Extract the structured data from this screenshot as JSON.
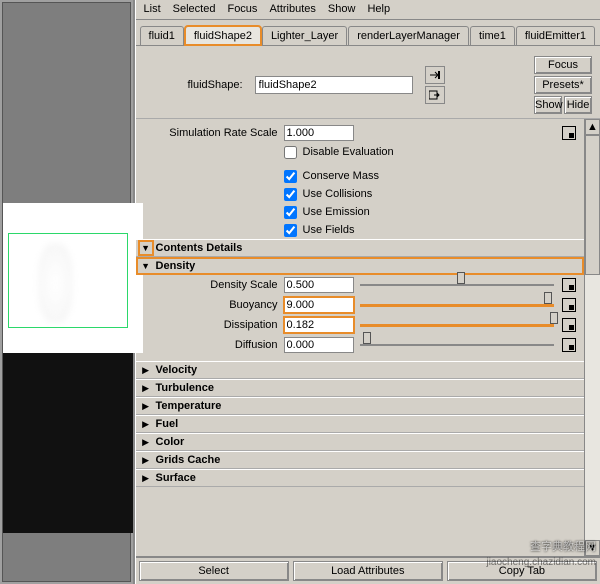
{
  "menu": {
    "items": [
      "List",
      "Selected",
      "Focus",
      "Attributes",
      "Show",
      "Help"
    ]
  },
  "tabs": [
    {
      "label": "fluid1"
    },
    {
      "label": "fluidShape2",
      "selected": true
    },
    {
      "label": "Lighter_Layer"
    },
    {
      "label": "renderLayerManager"
    },
    {
      "label": "time1"
    },
    {
      "label": "fluidEmitter1"
    }
  ],
  "header": {
    "shape_label": "fluidShape:",
    "shape_value": "fluidShape2",
    "buttons": {
      "focus": "Focus",
      "presets": "Presets*",
      "show": "Show",
      "hide": "Hide"
    }
  },
  "sim": {
    "rate_label": "Simulation Rate Scale",
    "rate_value": "1.000",
    "disable_eval": "Disable Evaluation",
    "conserve_mass": "Conserve Mass",
    "use_collisions": "Use Collisions",
    "use_emission": "Use Emission",
    "use_fields": "Use Fields"
  },
  "sections": {
    "contents_details": "Contents Details",
    "density": "Density",
    "velocity": "Velocity",
    "turbulence": "Turbulence",
    "temperature": "Temperature",
    "fuel": "Fuel",
    "color": "Color",
    "grids_cache": "Grids Cache",
    "surface": "Surface"
  },
  "density": {
    "scale": {
      "label": "Density Scale",
      "value": "0.500",
      "pos": 50
    },
    "buoyancy": {
      "label": "Buoyancy",
      "value": "9.000",
      "pos": 95
    },
    "dissipation": {
      "label": "Dissipation",
      "value": "0.182",
      "pos": 98
    },
    "diffusion": {
      "label": "Diffusion",
      "value": "0.000",
      "pos": 2
    }
  },
  "footer": {
    "select": "Select",
    "load": "Load Attributes",
    "copy": "Copy Tab"
  },
  "watermark": {
    "line1": "查字典教程网",
    "line2": "jiaocheng.chazidian.com"
  }
}
